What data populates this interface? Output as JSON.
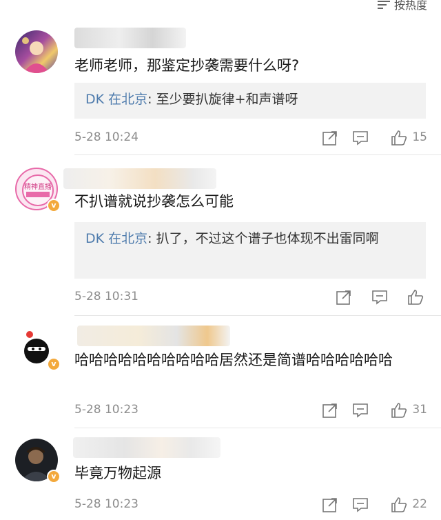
{
  "header": {
    "sort_label": "按热度",
    "sort_icon": "sort-icon"
  },
  "comments": [
    {
      "text": "老师老师，那鉴定抄袭需要什么呀?",
      "reply": {
        "author": "DK 在北京",
        "sep": ": ",
        "text": "至少要扒旋律+和声谱呀"
      },
      "time": "5-28 10:24",
      "likes": "15",
      "verified": false
    },
    {
      "text": "不扒谱就说抄袭怎么可能",
      "reply": {
        "author": "DK 在北京",
        "sep": ": ",
        "text": "扒了，不过这个谱子也体现不出雷同啊"
      },
      "time": "5-28 10:31",
      "likes": "",
      "verified": true,
      "avatar_text": "精神直播"
    },
    {
      "text": "哈哈哈哈哈哈哈哈哈哈居然还是简谱哈哈哈哈哈哈",
      "time": "5-28 10:23",
      "likes": "31",
      "verified": true
    },
    {
      "text": "毕竟万物起源",
      "time": "5-28 10:23",
      "likes": "22",
      "verified": true
    }
  ],
  "colors": {
    "link": "#4f7cad",
    "badge": "#f3a93c",
    "reply_bg": "#f2f2f2",
    "meta": "#8d8d8d"
  }
}
